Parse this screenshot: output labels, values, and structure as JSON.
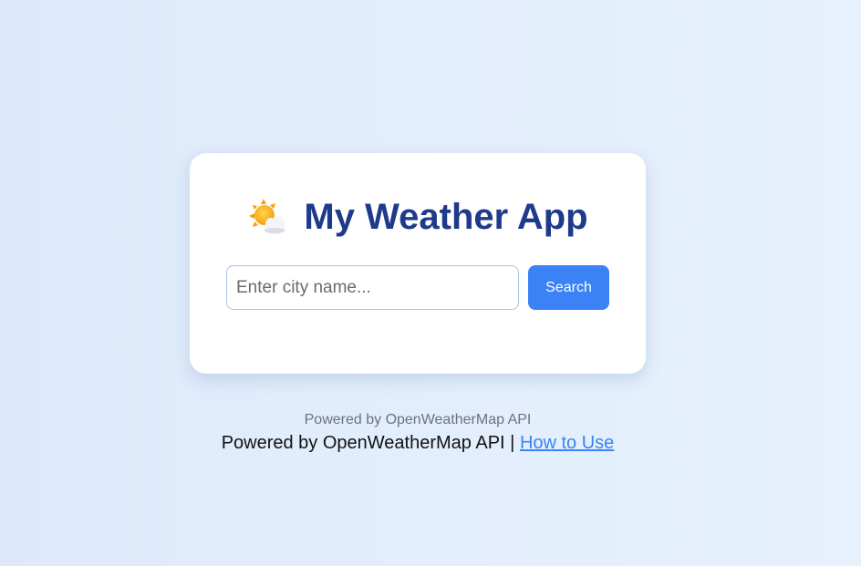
{
  "app": {
    "title": "My Weather App",
    "title_icon": "sun-behind-cloud-icon"
  },
  "search": {
    "placeholder": "Enter city name...",
    "value": "",
    "button_label": "Search"
  },
  "footer": {
    "small_text": "Powered by OpenWeatherMap API",
    "main_text": "Powered by OpenWeatherMap API",
    "separator": "|",
    "link_label": "How to Use"
  },
  "colors": {
    "accent": "#3b82f6",
    "title": "#1e3a8a",
    "background": "#e3eefc"
  }
}
